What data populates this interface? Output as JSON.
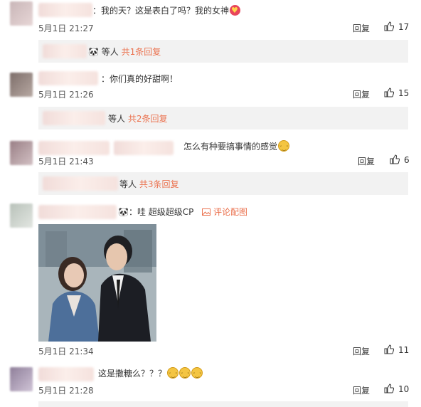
{
  "comments": [
    {
      "text": "：我的天？这是表白了吗？我的女神",
      "emojis": [
        "heart-eyes"
      ],
      "time": "5月1日 21:27",
      "reply_label": "回复",
      "likes": "17",
      "sub": {
        "suffix": "等人",
        "more": "共1条回复"
      }
    },
    {
      "text": "：你们真的好甜啊！",
      "time": "5月1日 21:26",
      "reply_label": "回复",
      "likes": "15",
      "sub": {
        "suffix": "等人",
        "more": "共2条回复"
      }
    },
    {
      "text": "怎么有种要搞事情的感觉",
      "emojis": [
        "doge"
      ],
      "time": "5月1日 21:43",
      "reply_label": "回复",
      "likes": "6",
      "sub": {
        "suffix": "等人",
        "more": "共3条回复"
      }
    },
    {
      "text": "：哇 超级超级CP",
      "image_link": "评论配图",
      "time": "5月1日 21:34",
      "reply_label": "回复",
      "likes": "11"
    },
    {
      "text": "这是撒糖么？？？",
      "emojis": [
        "doge",
        "doge",
        "doge"
      ],
      "time": "5月1日 21:28",
      "reply_label": "回复",
      "likes": "10"
    }
  ],
  "colors": {
    "accent": "#eb7350",
    "subbar_bg": "#f2f2f2",
    "text": "#333333"
  }
}
